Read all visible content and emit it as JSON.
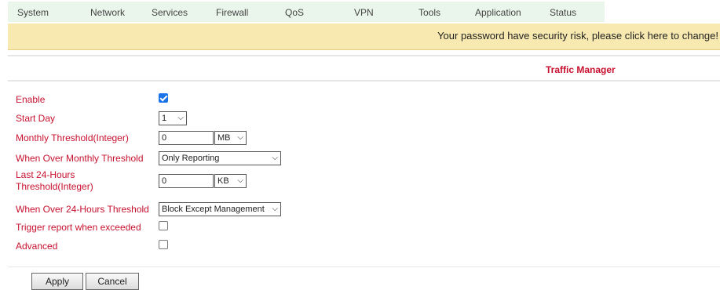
{
  "nav": {
    "items": [
      {
        "label": "System"
      },
      {
        "label": "Network"
      },
      {
        "label": "Services"
      },
      {
        "label": "Firewall"
      },
      {
        "label": "QoS"
      },
      {
        "label": "VPN"
      },
      {
        "label": "Tools"
      },
      {
        "label": "Application"
      },
      {
        "label": "Status"
      }
    ]
  },
  "warning": {
    "text": "Your password have security risk, please click here to change!"
  },
  "page": {
    "title": "Traffic Manager"
  },
  "form": {
    "enable": {
      "label": "Enable",
      "checked": true
    },
    "start_day": {
      "label": "Start Day",
      "value": "1"
    },
    "monthly_threshold": {
      "label": "Monthly Threshold(Integer)",
      "value": "0",
      "unit": "MB"
    },
    "over_monthly": {
      "label": "When Over Monthly Threshold",
      "value": "Only Reporting"
    },
    "last24": {
      "label_line1": "Last 24-Hours",
      "label_line2": "Threshold(Integer)",
      "value": "0",
      "unit": "KB"
    },
    "over_24h": {
      "label": "When Over 24-Hours Threshold",
      "value": "Block Except Management"
    },
    "trigger_report": {
      "label": "Trigger report when exceeded",
      "checked": false
    },
    "advanced": {
      "label": "Advanced",
      "checked": false
    }
  },
  "buttons": {
    "apply": "Apply",
    "cancel": "Cancel"
  },
  "colors": {
    "label_red": "#c8102e",
    "menu_bg": "#eaf6ec",
    "warning_bg": "#f7e9b0",
    "checkbox_blue": "#1a73e8"
  }
}
